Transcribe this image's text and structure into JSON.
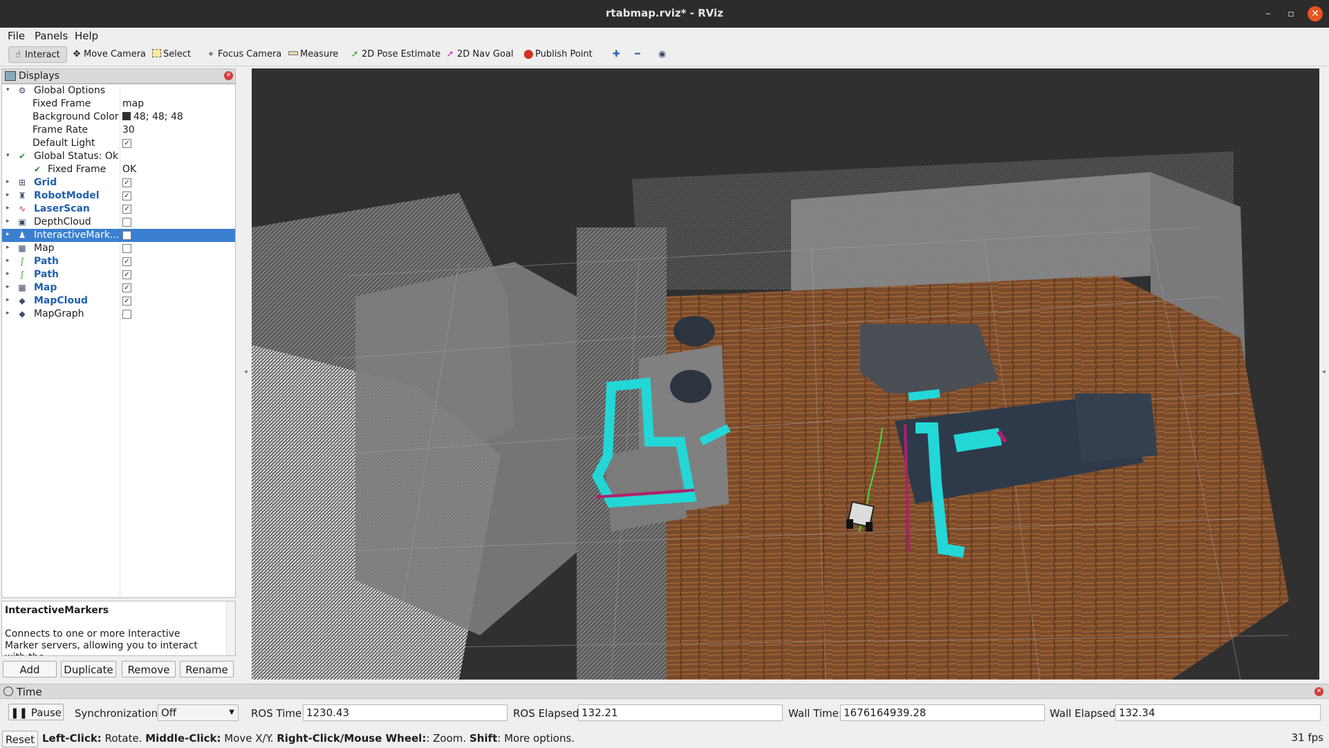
{
  "window": {
    "title": "rtabmap.rviz* - RViz",
    "minimize": "–",
    "maximize": "▫",
    "close": "✕"
  },
  "menu": [
    "File",
    "Panels",
    "Help"
  ],
  "toolbar": {
    "tools": [
      "Interact",
      "Move Camera",
      "Select",
      "Focus Camera",
      "Measure",
      "2D Pose Estimate",
      "2D Nav Goal",
      "Publish Point"
    ],
    "active_tool": "Interact"
  },
  "displays_panel": {
    "title": "Displays",
    "rows": [
      {
        "name": "Global Options",
        "value": ""
      },
      {
        "name": "Fixed Frame",
        "value": "map"
      },
      {
        "name": "Background Color",
        "value": "48; 48; 48"
      },
      {
        "name": "Frame Rate",
        "value": "30"
      },
      {
        "name": "Default Light",
        "value": ""
      },
      {
        "name": "Global Status: Ok",
        "value": ""
      },
      {
        "name": "Fixed Frame",
        "value": "OK"
      },
      {
        "name": "Grid",
        "value": ""
      },
      {
        "name": "RobotModel",
        "value": ""
      },
      {
        "name": "LaserScan",
        "value": ""
      },
      {
        "name": "DepthCloud",
        "value": ""
      },
      {
        "name": "InteractiveMark...",
        "value": ""
      },
      {
        "name": "Map",
        "value": ""
      },
      {
        "name": "Path",
        "value": ""
      },
      {
        "name": "Path",
        "value": ""
      },
      {
        "name": "Map",
        "value": ""
      },
      {
        "name": "MapCloud",
        "value": ""
      },
      {
        "name": "MapGraph",
        "value": ""
      }
    ],
    "checks": {
      "default_light": true,
      "grid": true,
      "robotmodel": true,
      "laserscan": true,
      "depthcloud": false,
      "interactivemarkers": false,
      "map1": false,
      "path1": true,
      "path2": true,
      "map2": true,
      "mapcloud": true,
      "mapgraph": false
    },
    "description": {
      "title": "InteractiveMarkers",
      "body": "Connects to one or more Interactive Marker servers, allowing you to interact with the"
    },
    "buttons": [
      "Add",
      "Duplicate",
      "Remove",
      "Rename"
    ]
  },
  "time_panel": {
    "title": "Time",
    "pause": "Pause",
    "sync_label": "Synchronization:",
    "sync_value": "Off",
    "ros_time_label": "ROS Time:",
    "ros_time": "1230.43",
    "ros_elapsed_label": "ROS Elapsed:",
    "ros_elapsed": "132.21",
    "wall_time_label": "Wall Time:",
    "wall_time": "1676164939.28",
    "wall_elapsed_label": "Wall Elapsed:",
    "wall_elapsed": "132.34"
  },
  "status": {
    "reset": "Reset",
    "hint_left_click": "Left-Click:",
    "hint_rotate": " Rotate. ",
    "hint_middle_click": "Middle-Click:",
    "hint_move": " Move X/Y. ",
    "hint_right_click": "Right-Click/Mouse Wheel:",
    "hint_zoom": ": Zoom. ",
    "hint_shift": "Shift",
    "hint_more": ": More options.",
    "fps": "31 fps"
  },
  "colors": {
    "background": "#303030",
    "selection": "#3b7fd0",
    "costmap": "#23d7d7",
    "inflation": "#b0206a",
    "path": "#38e038",
    "floor": "#7a4a2a"
  }
}
